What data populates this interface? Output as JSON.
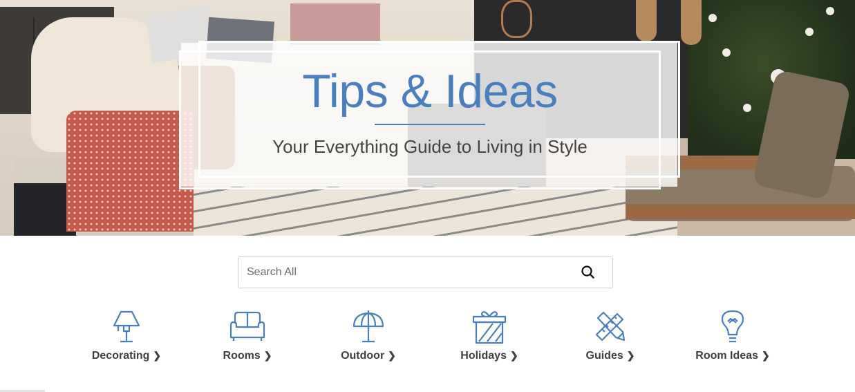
{
  "hero": {
    "title": "Tips & Ideas",
    "subtitle": "Your Everything Guide to Living in Style",
    "accent_color": "#4a7fbf"
  },
  "search": {
    "placeholder": "Search All",
    "value": "",
    "icon": "search-icon"
  },
  "categories": [
    {
      "label": "Decorating",
      "icon": "lamp-icon",
      "chevron": "›"
    },
    {
      "label": "Rooms",
      "icon": "sofa-icon",
      "chevron": "›"
    },
    {
      "label": "Outdoor",
      "icon": "umbrella-icon",
      "chevron": "›"
    },
    {
      "label": "Holidays",
      "icon": "gift-icon",
      "chevron": "›"
    },
    {
      "label": "Guides",
      "icon": "ruler-pencil-icon",
      "chevron": "›"
    },
    {
      "label": "Room Ideas",
      "icon": "lightbulb-icon",
      "chevron": "›"
    }
  ]
}
